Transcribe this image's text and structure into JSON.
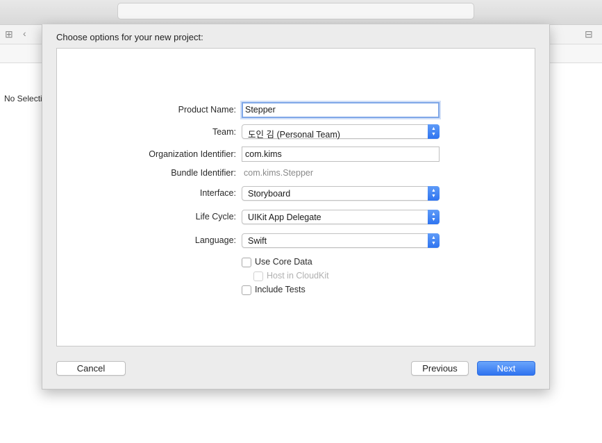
{
  "window": {
    "jump_bar_text": "No Selection"
  },
  "sheet": {
    "title": "Choose options for your new project:"
  },
  "form": {
    "product_name": {
      "label": "Product Name:",
      "value": "Stepper"
    },
    "team": {
      "label": "Team:",
      "value": "도인 김 (Personal Team)"
    },
    "organization_identifier": {
      "label": "Organization Identifier:",
      "value": "com.kims"
    },
    "bundle_identifier": {
      "label": "Bundle Identifier:",
      "value": "com.kims.Stepper"
    },
    "interface": {
      "label": "Interface:",
      "value": "Storyboard"
    },
    "life_cycle": {
      "label": "Life Cycle:",
      "value": "UIKit App Delegate"
    },
    "language": {
      "label": "Language:",
      "value": "Swift"
    },
    "use_core_data": {
      "label": "Use Core Data",
      "checked": false
    },
    "host_in_cloudkit": {
      "label": "Host in CloudKit",
      "checked": false,
      "enabled": false
    },
    "include_tests": {
      "label": "Include Tests",
      "checked": false
    }
  },
  "buttons": {
    "cancel": "Cancel",
    "previous": "Previous",
    "next": "Next"
  },
  "colors": {
    "accent": "#3478f6",
    "focus_ring": "#7fa7e8"
  }
}
